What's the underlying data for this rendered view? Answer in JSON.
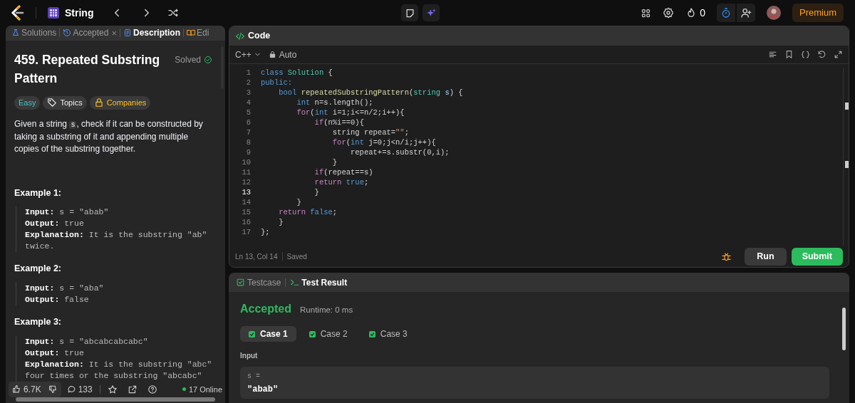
{
  "top_bar": {
    "list_name": "String",
    "streak": "0",
    "premium": "Premium"
  },
  "problem_tabs": [
    {
      "label": "Solutions",
      "selected": false
    },
    {
      "label": "Accepted",
      "close": "×",
      "selected": false
    },
    {
      "label": "Description",
      "selected": true
    },
    {
      "label": "Edi",
      "selected": false
    }
  ],
  "problem": {
    "title": "459. Repeated Substring Pattern",
    "status": "Solved",
    "tags": [
      {
        "label": "Easy",
        "kind": "difficulty"
      },
      {
        "label": "Topics",
        "kind": "topics"
      },
      {
        "label": "Companies",
        "kind": "companies"
      }
    ],
    "description": {
      "before": "Given a string ",
      "code": "s",
      "after": ", check if it can be constructed by taking a substring of it and appending multiple copies of the substring together."
    },
    "examples": [
      {
        "title": "Example 1:",
        "lines": [
          {
            "label": "Input:",
            "value": "s = \"abab\""
          },
          {
            "label": "Output:",
            "value": "true"
          },
          {
            "label": "Explanation:",
            "value": "It is the substring \"ab\" twice."
          }
        ]
      },
      {
        "title": "Example 2:",
        "lines": [
          {
            "label": "Input:",
            "value": "s = \"aba\""
          },
          {
            "label": "Output:",
            "value": "false"
          }
        ]
      },
      {
        "title": "Example 3:",
        "lines": [
          {
            "label": "Input:",
            "value": "s = \"abcabcabcabc\""
          },
          {
            "label": "Output:",
            "value": "true"
          },
          {
            "label": "Explanation:",
            "value": "It is the substring \"abc\" four times or the substring \"abcabc\""
          }
        ]
      }
    ]
  },
  "footer": {
    "likes": "6.7K",
    "comments": "133",
    "online": "17 Online"
  },
  "code_panel": {
    "title": "Code",
    "language": "C++",
    "mode": "Auto",
    "position": "Ln 13, Col 14",
    "save_state": "Saved",
    "run": "Run",
    "submit": "Submit",
    "lines": [
      {
        "number": "1",
        "active": false,
        "tokens": [
          {
            "text": "class ",
            "kind": "type"
          },
          {
            "text": "Solution",
            "kind": "cls"
          },
          {
            "text": " {",
            "kind": "plain"
          }
        ]
      },
      {
        "number": "2",
        "active": false,
        "tokens": [
          {
            "text": "public:",
            "kind": "type"
          }
        ]
      },
      {
        "number": "3",
        "active": false,
        "tokens": [
          {
            "text": "    bool ",
            "kind": "type"
          },
          {
            "text": "repeatedSubstringPattern",
            "kind": "fn"
          },
          {
            "text": "(",
            "kind": "plain"
          },
          {
            "text": "string ",
            "kind": "cls"
          },
          {
            "text": "s",
            "kind": "var"
          },
          {
            "text": ") {",
            "kind": "plain"
          }
        ]
      },
      {
        "number": "4",
        "active": false,
        "tokens": [
          {
            "text": "        int",
            "kind": "type"
          },
          {
            "text": " n=s.length();",
            "kind": "plain"
          }
        ]
      },
      {
        "number": "5",
        "active": false,
        "tokens": [
          {
            "text": "        for",
            "kind": "kw"
          },
          {
            "text": "(",
            "kind": "plain"
          },
          {
            "text": "int",
            "kind": "type"
          },
          {
            "text": " i=1;i<=n/2;i++){",
            "kind": "plain"
          }
        ]
      },
      {
        "number": "6",
        "active": false,
        "tokens": [
          {
            "text": "            if",
            "kind": "kw"
          },
          {
            "text": "(n%i==0){",
            "kind": "plain"
          }
        ]
      },
      {
        "number": "7",
        "active": false,
        "tokens": [
          {
            "text": "                string repeat=",
            "kind": "plain"
          },
          {
            "text": "\"\"",
            "kind": "str"
          },
          {
            "text": ";",
            "kind": "plain"
          }
        ]
      },
      {
        "number": "8",
        "active": false,
        "tokens": [
          {
            "text": "                for",
            "kind": "kw"
          },
          {
            "text": "(",
            "kind": "plain"
          },
          {
            "text": "int",
            "kind": "type"
          },
          {
            "text": " j=0;j<n/i;j++){",
            "kind": "plain"
          }
        ]
      },
      {
        "number": "9",
        "active": false,
        "tokens": [
          {
            "text": "                    repeat+=s.substr(0,i);",
            "kind": "plain"
          }
        ]
      },
      {
        "number": "10",
        "active": false,
        "tokens": [
          {
            "text": "                }",
            "kind": "plain"
          }
        ]
      },
      {
        "number": "11",
        "active": false,
        "tokens": [
          {
            "text": "            if",
            "kind": "kw"
          },
          {
            "text": "(repeat==s)",
            "kind": "plain"
          }
        ]
      },
      {
        "number": "12",
        "active": false,
        "tokens": [
          {
            "text": "            return ",
            "kind": "kw"
          },
          {
            "text": "true",
            "kind": "type"
          },
          {
            "text": ";",
            "kind": "plain"
          }
        ]
      },
      {
        "number": "13",
        "active": true,
        "tokens": [
          {
            "text": "            }",
            "kind": "plain"
          }
        ]
      },
      {
        "number": "14",
        "active": false,
        "tokens": [
          {
            "text": "        }",
            "kind": "plain"
          }
        ]
      },
      {
        "number": "15",
        "active": false,
        "tokens": [
          {
            "text": "    return ",
            "kind": "kw"
          },
          {
            "text": "false",
            "kind": "type"
          },
          {
            "text": ";",
            "kind": "plain"
          }
        ]
      },
      {
        "number": "16",
        "active": false,
        "tokens": [
          {
            "text": "    }",
            "kind": "plain"
          }
        ]
      },
      {
        "number": "17",
        "active": false,
        "tokens": [
          {
            "text": "};",
            "kind": "plain"
          }
        ]
      }
    ]
  },
  "result_panel": {
    "tabs": [
      {
        "label": "Testcase",
        "selected": false
      },
      {
        "label": "Test Result",
        "selected": true
      }
    ],
    "verdict": "Accepted",
    "runtime": "Runtime: 0 ms",
    "cases": [
      {
        "label": "Case 1",
        "selected": true,
        "passed": true
      },
      {
        "label": "Case 2",
        "selected": false,
        "passed": true
      },
      {
        "label": "Case 3",
        "selected": false,
        "passed": true
      }
    ],
    "input_label": "Input",
    "input_name": "s =",
    "input_value": "\"abab\""
  }
}
